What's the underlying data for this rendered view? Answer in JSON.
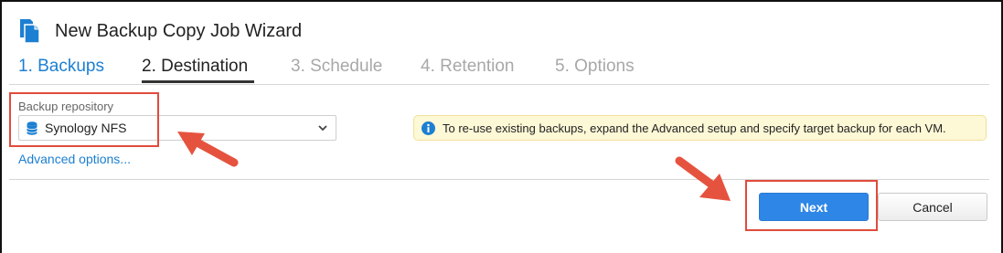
{
  "wizard": {
    "title": "New Backup Copy Job Wizard",
    "title_icon": "document-copy-icon"
  },
  "steps": [
    {
      "label": "1. Backups",
      "state": "completed"
    },
    {
      "label": "2. Destination",
      "state": "active"
    },
    {
      "label": "3. Schedule",
      "state": "pending"
    },
    {
      "label": "4. Retention",
      "state": "pending"
    },
    {
      "label": "5. Options",
      "state": "pending"
    }
  ],
  "destination": {
    "repository_label": "Backup repository",
    "repository_value": "Synology NFS",
    "repository_icon": "database-icon",
    "advanced_link": "Advanced options..."
  },
  "info": {
    "icon": "info-icon",
    "text": "To re-use existing backups, expand the Advanced setup and specify target backup for each VM."
  },
  "buttons": {
    "next": "Next",
    "cancel": "Cancel"
  },
  "colors": {
    "accent": "#1c7fd1",
    "primary_button": "#2e86e6",
    "highlight": "#e04b3b",
    "info_background": "#fdf8d6"
  }
}
